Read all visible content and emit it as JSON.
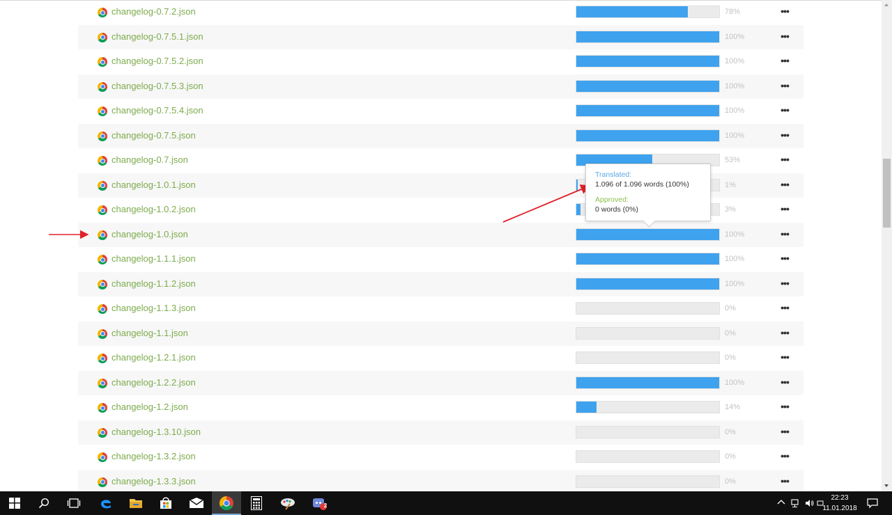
{
  "files": [
    {
      "name": "changelog-0.7.2.json",
      "pct_label": "78%",
      "progress": 78
    },
    {
      "name": "changelog-0.7.5.1.json",
      "pct_label": "100%",
      "progress": 100
    },
    {
      "name": "changelog-0.7.5.2.json",
      "pct_label": "100%",
      "progress": 100
    },
    {
      "name": "changelog-0.7.5.3.json",
      "pct_label": "100%",
      "progress": 100
    },
    {
      "name": "changelog-0.7.5.4.json",
      "pct_label": "100%",
      "progress": 100
    },
    {
      "name": "changelog-0.7.5.json",
      "pct_label": "100%",
      "progress": 100
    },
    {
      "name": "changelog-0.7.json",
      "pct_label": "53%",
      "progress": 53
    },
    {
      "name": "changelog-1.0.1.json",
      "pct_label": "1%",
      "progress": 1
    },
    {
      "name": "changelog-1.0.2.json",
      "pct_label": "3%",
      "progress": 3
    },
    {
      "name": "changelog-1.0.json",
      "pct_label": "100%",
      "progress": 100
    },
    {
      "name": "changelog-1.1.1.json",
      "pct_label": "100%",
      "progress": 100
    },
    {
      "name": "changelog-1.1.2.json",
      "pct_label": "100%",
      "progress": 100
    },
    {
      "name": "changelog-1.1.3.json",
      "pct_label": "0%",
      "progress": 0
    },
    {
      "name": "changelog-1.1.json",
      "pct_label": "0%",
      "progress": 0
    },
    {
      "name": "changelog-1.2.1.json",
      "pct_label": "0%",
      "progress": 0
    },
    {
      "name": "changelog-1.2.2.json",
      "pct_label": "100%",
      "progress": 100
    },
    {
      "name": "changelog-1.2.json",
      "pct_label": "14%",
      "progress": 14
    },
    {
      "name": "changelog-1.3.10.json",
      "pct_label": "0%",
      "progress": 0
    },
    {
      "name": "changelog-1.3.2.json",
      "pct_label": "0%",
      "progress": 0
    },
    {
      "name": "changelog-1.3.3.json",
      "pct_label": "0%",
      "progress": 0
    }
  ],
  "tooltip": {
    "translated_label": "Translated:",
    "translated_value": "1.096 of 1.096 words (100%)",
    "approved_label": "Approved:",
    "approved_value": "0 words (0%)"
  },
  "more_label": "•••",
  "colors": {
    "file_link": "#7cab4c",
    "progress_fill": "#3ea2ee",
    "progress_track": "#ebebeb",
    "translated_label": "#5aa6e6",
    "approved_label": "#8bbf4a",
    "annotation_arrow": "#e0202a"
  },
  "taskbar": {
    "apps": [
      "start-icon",
      "search-icon",
      "task-view-icon",
      "edge-icon",
      "file-explorer-icon",
      "store-icon",
      "mail-icon",
      "chrome-icon",
      "calculator-icon",
      "paint-icon",
      "discord-icon"
    ],
    "discord_badge": "2",
    "time": "22:23",
    "date": "11.01.2018"
  }
}
